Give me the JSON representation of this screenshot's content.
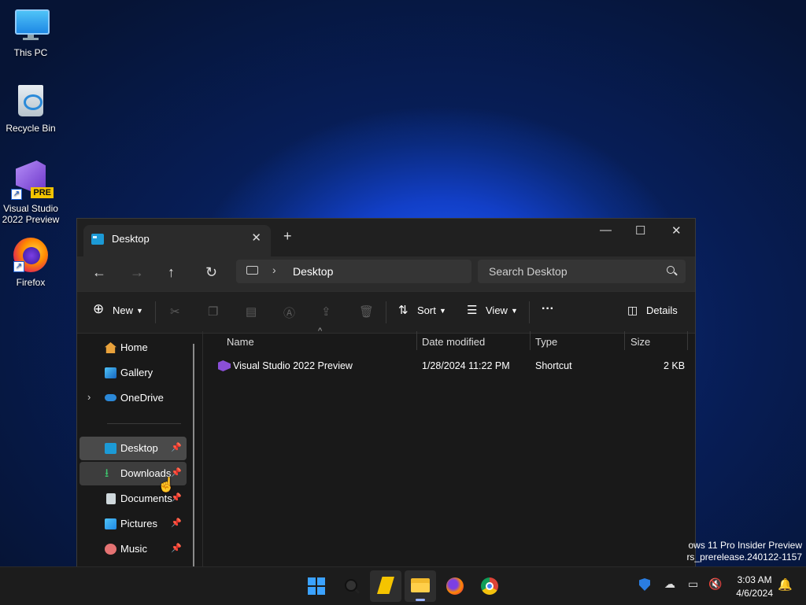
{
  "desktop": {
    "icons": [
      {
        "label": "This PC"
      },
      {
        "label": "Recycle Bin"
      },
      {
        "label": "Visual Studio 2022 Preview",
        "badge": "PRE"
      },
      {
        "label": "Firefox"
      }
    ]
  },
  "window": {
    "tab_title": "Desktop",
    "tab_close": "✕",
    "new_tab": "+",
    "minimize": "—",
    "maximize": "☐",
    "close": "✕",
    "nav": {
      "back": "←",
      "forward": "→",
      "up": "↑",
      "refresh": "↻"
    },
    "address": {
      "separator": "›",
      "crumb": "Desktop"
    },
    "search_placeholder": "Search Desktop",
    "toolbar": {
      "new": "New",
      "sort": "Sort",
      "view": "View",
      "more": "···",
      "details": "Details"
    },
    "sidebar": [
      {
        "label": "Home"
      },
      {
        "label": "Gallery"
      },
      {
        "label": "OneDrive",
        "expander": "›"
      },
      {
        "label": "Desktop",
        "pin": "📌"
      },
      {
        "label": "Downloads",
        "pin": "📌"
      },
      {
        "label": "Documents",
        "pin": "📌"
      },
      {
        "label": "Pictures",
        "pin": "📌"
      },
      {
        "label": "Music",
        "pin": "📌"
      }
    ],
    "columns": [
      "Name",
      "Date modified",
      "Type",
      "Size"
    ],
    "sort_indicator": "^",
    "files": [
      {
        "name": "Visual Studio 2022 Preview",
        "date": "1/28/2024 11:22 PM",
        "type": "Shortcut",
        "size": "2 KB"
      }
    ]
  },
  "watermark": {
    "line1": "ows 11 Pro Insider Preview",
    "line2": "rs_prerelease.240122-1157"
  },
  "taskbar": {
    "time": "3:03 AM",
    "date": "4/6/2024"
  },
  "colors": {
    "accent": "#4c8dff",
    "window_bg": "#191919",
    "taskbar_bg": "#1c1c1c"
  }
}
